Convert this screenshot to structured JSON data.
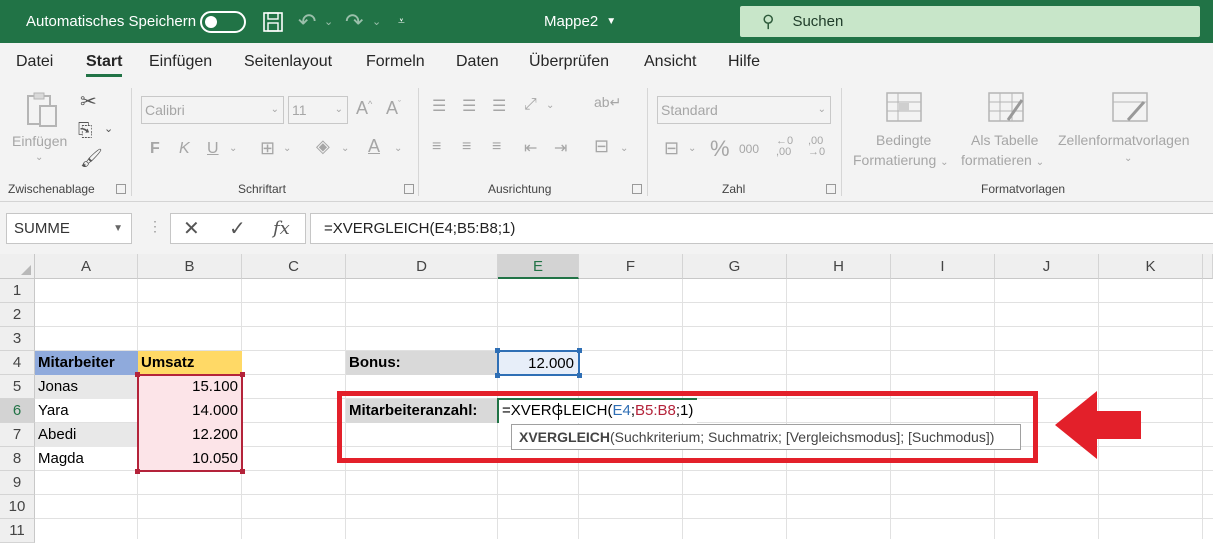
{
  "titlebar": {
    "autosave_label": "Automatisches Speichern",
    "doc_title": "Mappe2",
    "search_placeholder": "Suchen"
  },
  "tabs": [
    "Datei",
    "Start",
    "Einfügen",
    "Seitenlayout",
    "Formeln",
    "Daten",
    "Überprüfen",
    "Ansicht",
    "Hilfe"
  ],
  "active_tab": "Start",
  "ribbon": {
    "clipboard": {
      "paste_label": "Einfügen",
      "group_label": "Zwischenablage"
    },
    "font": {
      "font_name": "Calibri",
      "font_size": "11",
      "bold": "F",
      "italic": "K",
      "underline": "U",
      "group_label": "Schriftart"
    },
    "alignment": {
      "group_label": "Ausrichtung"
    },
    "number": {
      "format": "Standard",
      "percent": "%",
      "thousands": "000",
      "group_label": "Zahl"
    },
    "styles": {
      "conditional_1": "Bedingte",
      "conditional_2": "Formatierung",
      "as_table_1": "Als Tabelle",
      "as_table_2": "formatieren",
      "cell_styles": "Zellenformatvorlagen",
      "group_label": "Formatvorlagen"
    }
  },
  "formula_bar": {
    "name_box": "SUMME",
    "fx": "fx",
    "formula": "=XVERGLEICH(E4;B5:B8;1)"
  },
  "grid": {
    "columns": [
      "A",
      "B",
      "C",
      "D",
      "E",
      "F",
      "G",
      "H",
      "I",
      "J",
      "K"
    ],
    "rows": [
      "1",
      "2",
      "3",
      "4",
      "5",
      "6",
      "7",
      "8",
      "9",
      "10",
      "11"
    ],
    "selected_column": "E",
    "selected_row": "6",
    "headers": {
      "employee": "Mitarbeiter",
      "revenue": "Umsatz"
    },
    "employees": [
      {
        "name": "Jonas",
        "revenue": "15.100"
      },
      {
        "name": "Yara",
        "revenue": "14.000"
      },
      {
        "name": "Abedi",
        "revenue": "12.200"
      },
      {
        "name": "Magda",
        "revenue": "10.050"
      }
    ],
    "bonus_label": "Bonus:",
    "bonus_value": "12.000",
    "count_label": "Mitarbeiteranzahl:",
    "edit_formula": {
      "prefix": "=XVERGLEICH(",
      "arg1": "E4",
      "sep1": ";",
      "arg2": "B5:B8",
      "rest": ";1)"
    },
    "tooltip": {
      "function": "XVERGLEICH",
      "args": "(Suchkriterium; Suchmatrix; [Vergleichsmodus]; [Suchmodus])"
    }
  },
  "colors": {
    "excel_green": "#217346",
    "header_blue": "#8faadc",
    "header_yellow": "#ffd966",
    "range_pink": "#fce4e8",
    "highlight_red": "#e3202a",
    "ref_blue": "#2f6fb5",
    "ref_red": "#b4233a"
  }
}
